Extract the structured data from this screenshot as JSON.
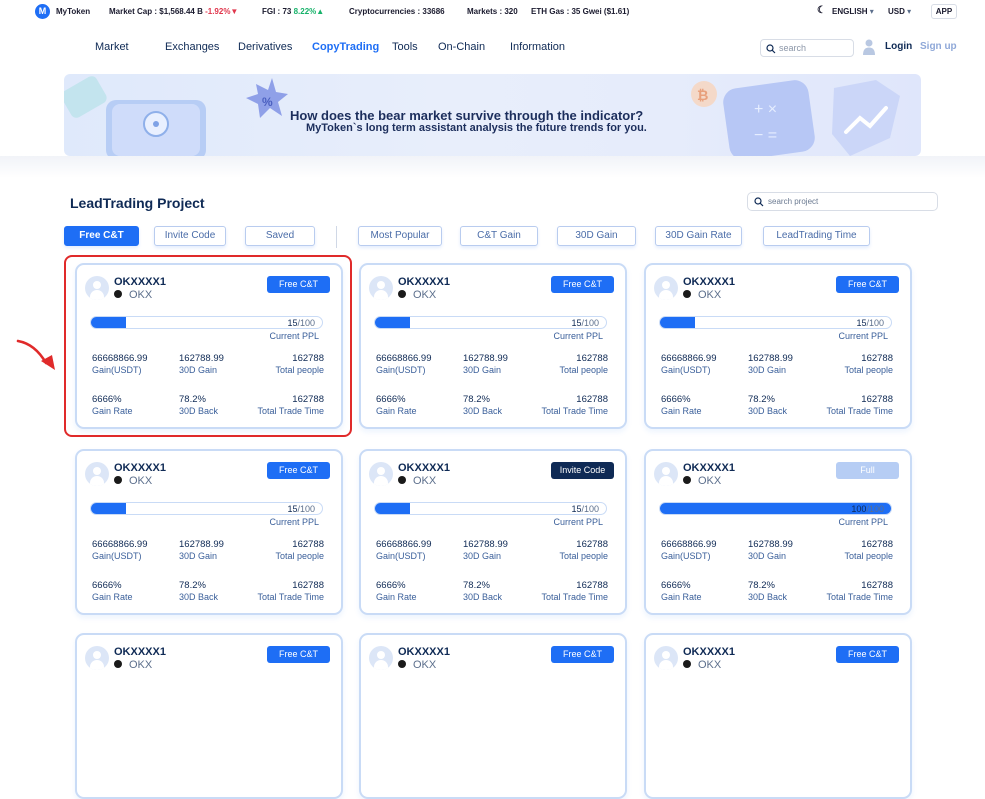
{
  "ticker": {
    "brand": "MyToken",
    "market_cap_label": "Market Cap :",
    "market_cap": "$1,568.44 B",
    "market_cap_change": "-1.92%▼",
    "fgi_label": "FGI :",
    "fgi": "73",
    "fgi_change": "8.22%▲",
    "crypto_label": "Cryptocurrencies :",
    "crypto": "33686",
    "markets_label": "Markets :",
    "markets": "320",
    "gas_label": "ETH Gas :",
    "gas": "35 Gwei ($1.61)",
    "language": "ENGLISH",
    "currency": "USD",
    "app": "APP"
  },
  "nav": {
    "items": [
      "Market",
      "Exchanges",
      "Derivatives",
      "CopyTrading",
      "Tools",
      "On-Chain",
      "Information"
    ],
    "active": "CopyTrading",
    "search_placeholder": "search",
    "login": "Login",
    "signup": "Sign up"
  },
  "banner": {
    "title": "How does the bear market  survive through the indicator?",
    "subtitle": "MyToken`s long term assistant analysis the future trends for you."
  },
  "section": {
    "title": "LeadTrading Project",
    "search_placeholder": "search project",
    "tabs": [
      "Free C&T",
      "Invite Code",
      "Saved"
    ],
    "sorts": [
      "Most Popular",
      "C&T Gain",
      "30D Gain",
      "30D Gain Rate",
      "LeadTrading Time"
    ]
  },
  "labels": {
    "current_ppl": "Current PPL",
    "gain_usdt": "Gain(USDT)",
    "gain_30d": "30D Gain",
    "total_people": "Total people",
    "gain_rate": "Gain Rate",
    "back_30d": "30D Back",
    "total_trade_time": "Total Trade Time"
  },
  "cards": [
    {
      "name": "OKXXXX1",
      "exchange": "OKX",
      "button": "Free C&T",
      "button_type": "free",
      "current": "15",
      "max": "100",
      "progress": 0.15,
      "gain": "66668866.99",
      "gain30": "162788.99",
      "people": "162788",
      "rate": "6666%",
      "back": "78.2%",
      "trade_time": "162788"
    },
    {
      "name": "OKXXXX1",
      "exchange": "OKX",
      "button": "Free C&T",
      "button_type": "free",
      "current": "15",
      "max": "100",
      "progress": 0.15,
      "gain": "66668866.99",
      "gain30": "162788.99",
      "people": "162788",
      "rate": "6666%",
      "back": "78.2%",
      "trade_time": "162788"
    },
    {
      "name": "OKXXXX1",
      "exchange": "OKX",
      "button": "Free C&T",
      "button_type": "free",
      "current": "15",
      "max": "100",
      "progress": 0.15,
      "gain": "66668866.99",
      "gain30": "162788.99",
      "people": "162788",
      "rate": "6666%",
      "back": "78.2%",
      "trade_time": "162788"
    },
    {
      "name": "OKXXXX1",
      "exchange": "OKX",
      "button": "Free C&T",
      "button_type": "free",
      "current": "15",
      "max": "100",
      "progress": 0.15,
      "gain": "66668866.99",
      "gain30": "162788.99",
      "people": "162788",
      "rate": "6666%",
      "back": "78.2%",
      "trade_time": "162788"
    },
    {
      "name": "OKXXXX1",
      "exchange": "OKX",
      "button": "Invite Code",
      "button_type": "invite",
      "current": "15",
      "max": "100",
      "progress": 0.15,
      "gain": "66668866.99",
      "gain30": "162788.99",
      "people": "162788",
      "rate": "6666%",
      "back": "78.2%",
      "trade_time": "162788"
    },
    {
      "name": "OKXXXX1",
      "exchange": "OKX",
      "button": "Full",
      "button_type": "full",
      "current": "100",
      "max": "100",
      "progress": 1.0,
      "gain": "66668866.99",
      "gain30": "162788.99",
      "people": "162788",
      "rate": "6666%",
      "back": "78.2%",
      "trade_time": "162788"
    },
    {
      "name": "OKXXXX1",
      "exchange": "OKX",
      "button": "Free C&T",
      "button_type": "free"
    },
    {
      "name": "OKXXXX1",
      "exchange": "OKX",
      "button": "Free C&T",
      "button_type": "free"
    },
    {
      "name": "OKXXXX1",
      "exchange": "OKX",
      "button": "Free C&T",
      "button_type": "free"
    }
  ],
  "colors": {
    "accent": "#1e6ef5",
    "navy": "#0f2a55",
    "highlight": "#e02a2a",
    "down": "#e0364c",
    "up": "#17b26a"
  }
}
